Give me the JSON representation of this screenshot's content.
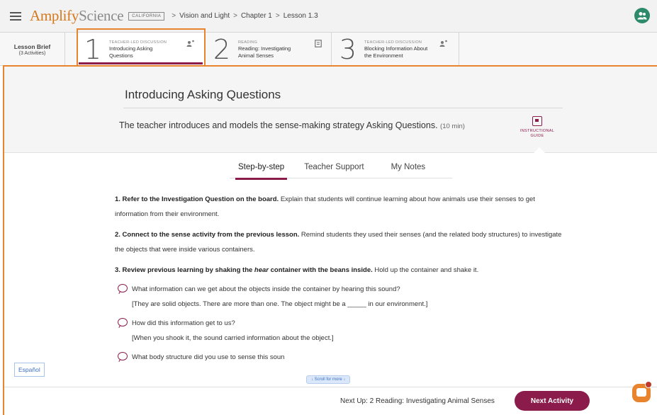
{
  "app": {
    "brand_main": "Amplify",
    "brand_sub": "Science",
    "state_badge": "CALIFORNIA"
  },
  "breadcrumb": {
    "items": [
      "Vision and Light",
      "Chapter 1",
      "Lesson 1.3"
    ],
    "separator": ">"
  },
  "lesson_brief": {
    "label": "Lesson Brief",
    "count": "(3 Activities)"
  },
  "activities": [
    {
      "number": "1",
      "type": "TEACHER-LED DISCUSSION",
      "title_line1": "Introducing Asking",
      "title_line2": "Questions",
      "icon": "teacher-discussion-icon"
    },
    {
      "number": "2",
      "type": "READING",
      "title_line1": "Reading: Investigating",
      "title_line2": "Animal Senses",
      "icon": "book-icon"
    },
    {
      "number": "3",
      "type": "TEACHER-LED DISCUSSION",
      "title_line1": "Blocking Information About",
      "title_line2": "the Environment",
      "icon": "teacher-discussion-icon"
    }
  ],
  "activity": {
    "title": "Introducing Asking Questions",
    "description": "The teacher introduces and models the sense-making strategy Asking Questions.",
    "duration": "(10 min)",
    "guide_line1": "INSTRUCTIONAL",
    "guide_line2": "GUIDE"
  },
  "subtabs": [
    "Step-by-step",
    "Teacher Support",
    "My Notes"
  ],
  "steps": [
    {
      "bold": "1. Refer to the Investigation Question on the board.",
      "text": " Explain that students will continue learning about how animals use their senses to get information from their environment."
    },
    {
      "bold": "2. Connect to the sense activity from the previous lesson.",
      "text": " Remind students they used their senses (and the related body structures) to investigate the objects that were inside various containers."
    },
    {
      "bold_a": "3. Review previous learning by shaking the ",
      "bold_italic": "hear",
      "bold_b": " container with the beans inside.",
      "text": " Hold up the container and shake it."
    }
  ],
  "questions": [
    {
      "question": "What information can we get about the objects inside the container by hearing this sound?",
      "answer": "[They are solid objects. There are more than one. The object might be a _____ in our environment.]"
    },
    {
      "question": "How did this information get to us?",
      "answer": "[When you shook it, the sound carried information about the object.]"
    },
    {
      "question": "What body structure did you use to sense this soun",
      "answer": ""
    }
  ],
  "scroll_hint": "↓  Scroll for more  ↓",
  "espanol": "Español",
  "footer": {
    "next_up": "Next Up: 2 Reading: Investigating Animal Senses",
    "next_button": "Next Activity"
  },
  "colors": {
    "brand_orange": "#d4781c",
    "accent_magenta": "#8b1b4a",
    "highlight_orange": "#e8832e",
    "link_blue": "#3b6fc2"
  }
}
